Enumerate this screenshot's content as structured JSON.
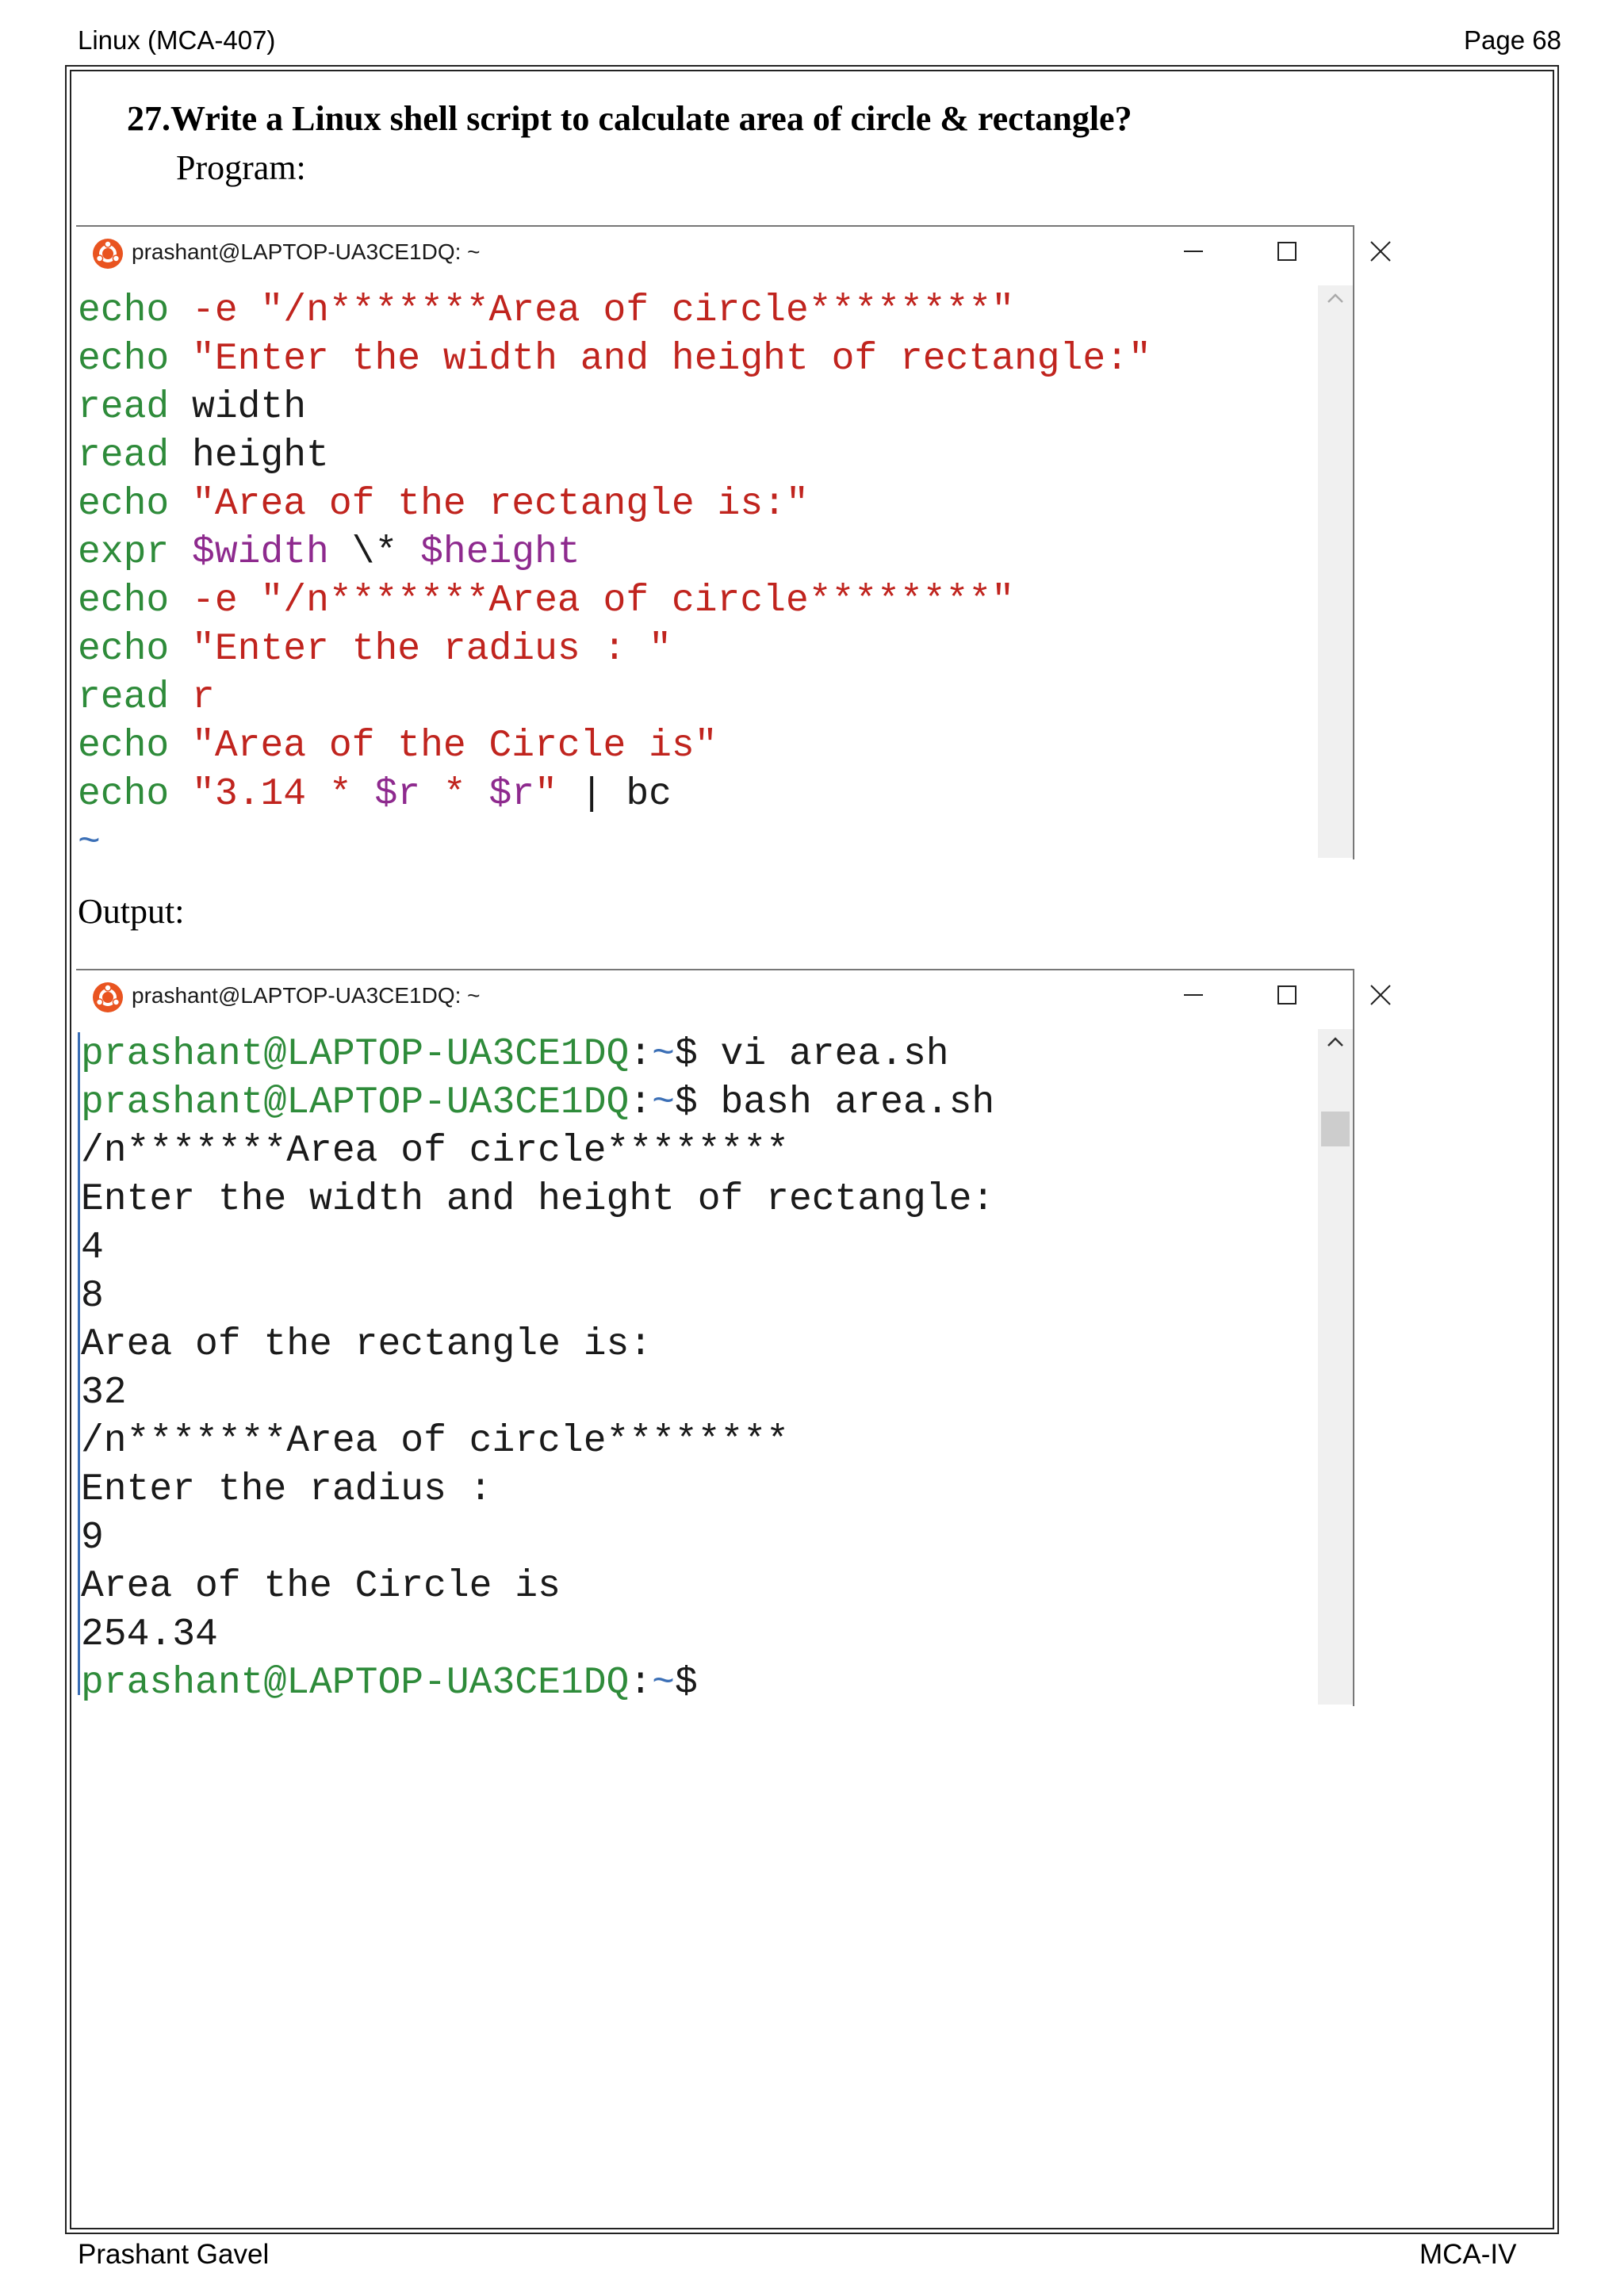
{
  "header": {
    "left": "Linux (MCA-407)",
    "right": "Page 68"
  },
  "footer": {
    "left": "Prashant Gavel",
    "right": "MCA-IV"
  },
  "question": "27.Write a Linux shell script to calculate area of circle & rectangle?",
  "program_label": "Program:",
  "output_label": "Output:",
  "terminal_program": {
    "title": "prashant@LAPTOP-UA3CE1DQ: ~",
    "lines": [
      [
        [
          "g",
          "echo"
        ],
        [
          "b",
          " "
        ],
        [
          "r",
          "-e"
        ],
        [
          "b",
          " "
        ],
        [
          "r",
          "\"/n*******Area of circle********\""
        ]
      ],
      [
        [
          "g",
          "echo"
        ],
        [
          "b",
          " "
        ],
        [
          "r",
          "\"Enter the width and height of rectangle:\""
        ]
      ],
      [
        [
          "g",
          "read"
        ],
        [
          "b",
          " width"
        ]
      ],
      [
        [
          "g",
          "read"
        ],
        [
          "b",
          " height"
        ]
      ],
      [
        [
          "g",
          "echo"
        ],
        [
          "b",
          " "
        ],
        [
          "r",
          "\"Area of the rectangle is:\""
        ]
      ],
      [
        [
          "g",
          "expr"
        ],
        [
          "b",
          " "
        ],
        [
          "p",
          "$width"
        ],
        [
          "b",
          " \\* "
        ],
        [
          "p",
          "$height"
        ]
      ],
      [
        [
          "g",
          "echo"
        ],
        [
          "b",
          " "
        ],
        [
          "r",
          "-e"
        ],
        [
          "b",
          " "
        ],
        [
          "r",
          "\"/n*******Area of circle********\""
        ]
      ],
      [
        [
          "g",
          "echo"
        ],
        [
          "b",
          " "
        ],
        [
          "r",
          "\"Enter the radius : \""
        ]
      ],
      [
        [
          "g",
          "read"
        ],
        [
          "b",
          " "
        ],
        [
          "r",
          "r"
        ]
      ],
      [
        [
          "g",
          "echo"
        ],
        [
          "b",
          " "
        ],
        [
          "r",
          "\"Area of the Circle is\""
        ]
      ],
      [
        [
          "g",
          "echo"
        ],
        [
          "b",
          " "
        ],
        [
          "r",
          "\"3.14 * "
        ],
        [
          "p",
          "$r"
        ],
        [
          "r",
          " * "
        ],
        [
          "p",
          "$r"
        ],
        [
          "r",
          "\""
        ],
        [
          "b",
          " | bc"
        ]
      ],
      [
        [
          "lb",
          "~"
        ]
      ]
    ]
  },
  "terminal_output": {
    "title": "prashant@LAPTOP-UA3CE1DQ: ~",
    "lines": [
      [
        [
          "g",
          "prashant@LAPTOP-UA3CE1DQ"
        ],
        [
          "b",
          ":"
        ],
        [
          "lb",
          "~"
        ],
        [
          "b",
          "$ vi area.sh"
        ]
      ],
      [
        [
          "g",
          "prashant@LAPTOP-UA3CE1DQ"
        ],
        [
          "b",
          ":"
        ],
        [
          "lb",
          "~"
        ],
        [
          "b",
          "$ bash area.sh"
        ]
      ],
      [
        [
          "b",
          "/n*******Area of circle********"
        ]
      ],
      [
        [
          "b",
          "Enter the width and height of rectangle:"
        ]
      ],
      [
        [
          "b",
          "4"
        ]
      ],
      [
        [
          "b",
          "8"
        ]
      ],
      [
        [
          "b",
          "Area of the rectangle is:"
        ]
      ],
      [
        [
          "b",
          "32"
        ]
      ],
      [
        [
          "b",
          "/n*******Area of circle********"
        ]
      ],
      [
        [
          "b",
          "Enter the radius :"
        ]
      ],
      [
        [
          "b",
          "9"
        ]
      ],
      [
        [
          "b",
          "Area of the Circle is"
        ]
      ],
      [
        [
          "b",
          "254.34"
        ]
      ],
      [
        [
          "g",
          "prashant@LAPTOP-UA3CE1DQ"
        ],
        [
          "b",
          ":"
        ],
        [
          "lb",
          "~"
        ],
        [
          "b",
          "$"
        ]
      ]
    ]
  },
  "icons": {
    "app": "ubuntu-logo-icon",
    "minimize": "minimize-icon",
    "maximize": "maximize-icon",
    "close": "close-icon",
    "scroll_up": "chevron-up-icon"
  },
  "colors": {
    "keyword": "#2e8b3a",
    "string": "#c0241e",
    "variable": "#8e2a8e",
    "text": "#1a1a1a",
    "tilde": "#3b6fb6",
    "ubuntu": "#e95420"
  }
}
